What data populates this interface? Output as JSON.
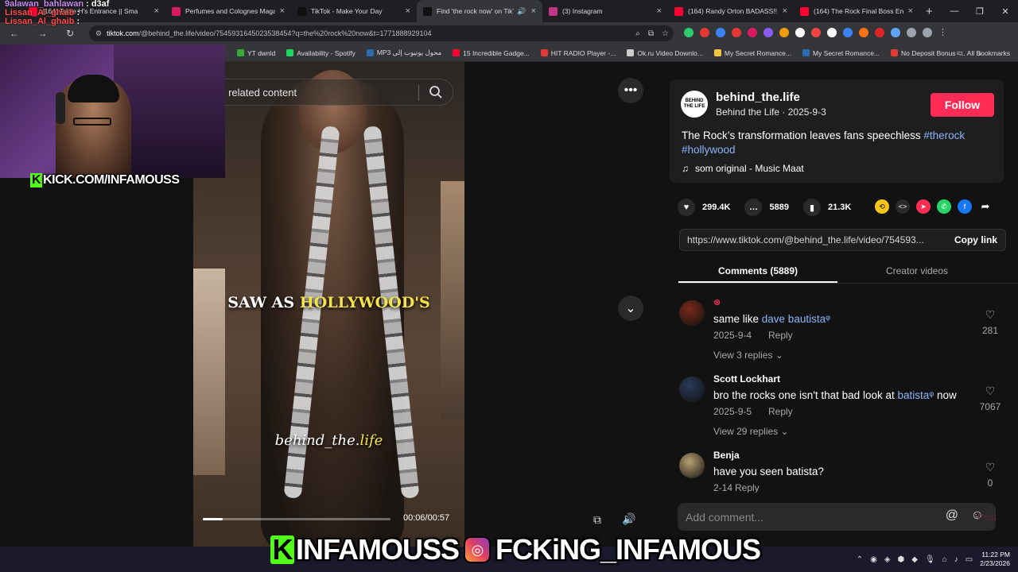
{
  "browser": {
    "tabs": [
      {
        "label": "(164) Triple H's Entrance || Sma",
        "color": "#ff0033",
        "width": 180
      },
      {
        "label": "Perfumes and Colognes Magaz",
        "color": "#d81b60",
        "width": 158
      },
      {
        "label": "TikTok - Make Your Day",
        "color": "#111111",
        "width": 158
      },
      {
        "label": "Find 'the rock now' on TikTok",
        "color": "#111111",
        "width": 158,
        "active": true
      },
      {
        "label": "(3) Instagram",
        "color": "#c13584",
        "width": 158
      },
      {
        "label": "(164) Randy Orton BADASS!! E",
        "color": "#ff0033",
        "width": 158
      },
      {
        "label": "(164) The Rock Final Boss Entra",
        "color": "#ff0033",
        "width": 158
      }
    ],
    "url_domain": "tiktok.com",
    "url_rest": "/@behind_the.life/video/7545931645023538454?q=the%20rock%20now&t=1771888929104",
    "bookmarks": [
      {
        "label": "YT dwnld",
        "color": "#3aaa35"
      },
      {
        "label": "Availability - Spotify",
        "color": "#1ed760"
      },
      {
        "label": "MP3 محول يوتيوب إلى",
        "color": "#2b6cb0"
      },
      {
        "label": "15 Incredible Gadge...",
        "color": "#ff0033"
      },
      {
        "label": "HIT RADIO Player -...",
        "color": "#e53935"
      },
      {
        "label": "Ok.ru Video Downlo...",
        "color": "#cccccc"
      },
      {
        "label": "My Secret Romance...",
        "color": "#f5c542"
      },
      {
        "label": "My Secret Romance...",
        "color": "#2b6cb0"
      },
      {
        "label": "No Deposit Bonus -...",
        "color": "#e53935"
      }
    ],
    "all_bookmarks": "All Bookmarks"
  },
  "stream": {
    "chat": [
      {
        "user": "9alawan_bahlawan",
        "msg": ": d3af"
      },
      {
        "user": "Lissan_Al_ghaib",
        "msg": ":"
      },
      {
        "user": "Lissan_Al_ghaib",
        "msg": ":"
      }
    ],
    "kick_label": "KICK.COM/INFAMOUSS",
    "banner_kick": "INFAMOUSS",
    "banner_ig": "FCKiNG_INFAMOUS"
  },
  "video": {
    "search_placeholder": "nd related content",
    "caption_a": "SAW AS ",
    "caption_b": "HOLLYWOOD'S",
    "watermark_a": "behind_the.",
    "watermark_b": "life",
    "time": "00:06/00:57",
    "progress": 0.105
  },
  "post": {
    "avatar_text": "BEHIND THE LIFE",
    "username": "behind_the.life",
    "subline": "Behind the Life · 2025-9-3",
    "follow": "Follow",
    "desc_text": "The Rock’s transformation leaves fans speechless ",
    "tag1": "#therock",
    "tag2": "#hollywood",
    "music": "som original - Music Maat",
    "likes": "299.4K",
    "comments_count": "5889",
    "saves": "21.3K",
    "link": "https://www.tiktok.com/@behind_the.life/video/754593...",
    "copy_link": "Copy link",
    "tab_comments": "Comments (5889)",
    "tab_creator": "Creator videos",
    "add_comment": "Add comment...",
    "post_btn": "Post"
  },
  "comments": [
    {
      "user": "",
      "pre": "same like ",
      "link": "dave bautista",
      "post": "",
      "date": "2025-9-4",
      "reply": "Reply",
      "view": "View 3 replies",
      "likes": "281",
      "avatar": "#7a2a1a"
    },
    {
      "user": "Scott  Lockhart",
      "pre": "bro the rocks one isn't that bad look at ",
      "link": "batista",
      "post": " now",
      "date": "2025-9-5",
      "reply": "Reply",
      "view": "View 29 replies",
      "likes": "7067",
      "avatar": "#2a3a5a"
    },
    {
      "user": "Benja",
      "pre": "have you seen batista?",
      "link": "",
      "post": "",
      "date": "2-14",
      "reply": "Reply",
      "view": "",
      "likes": "0",
      "avatar": "#b8a070"
    }
  ],
  "taskbar": {
    "time": "11:22 PM",
    "date": "2/23/2026"
  }
}
